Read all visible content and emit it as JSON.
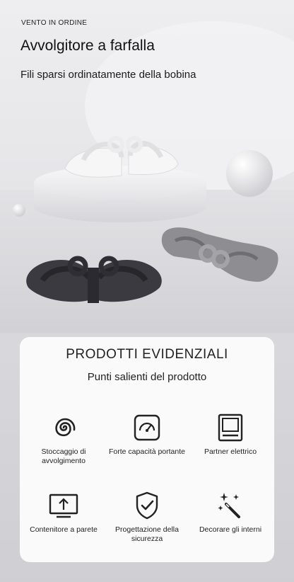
{
  "hero": {
    "tag": "VENTO IN ORDINE",
    "title": "Avvolgitore a farfalla",
    "subtitle": "Fili sparsi ordinatamente della bobina"
  },
  "card": {
    "title": "PRODOTTI EVIDENZIALI",
    "subtitle": "Punti salienti del prodotto",
    "features": [
      {
        "icon": "spiral-icon",
        "label": "Stoccaggio di avvolgimento"
      },
      {
        "icon": "gauge-icon",
        "label": "Forte capacità portante"
      },
      {
        "icon": "monitor-icon",
        "label": "Partner elettrico"
      },
      {
        "icon": "upload-screen-icon",
        "label": "Contenitore a parete"
      },
      {
        "icon": "shield-check-icon",
        "label": "Progettazione della sicurezza"
      },
      {
        "icon": "magic-wand-icon",
        "label": "Decorare gli interni"
      }
    ]
  },
  "colors": {
    "background": "#d6d6d9",
    "card": "#fafafa",
    "winder_white": "#f4f4f4",
    "winder_dark": "#3a3a40",
    "winder_gray": "#8e8e92"
  }
}
